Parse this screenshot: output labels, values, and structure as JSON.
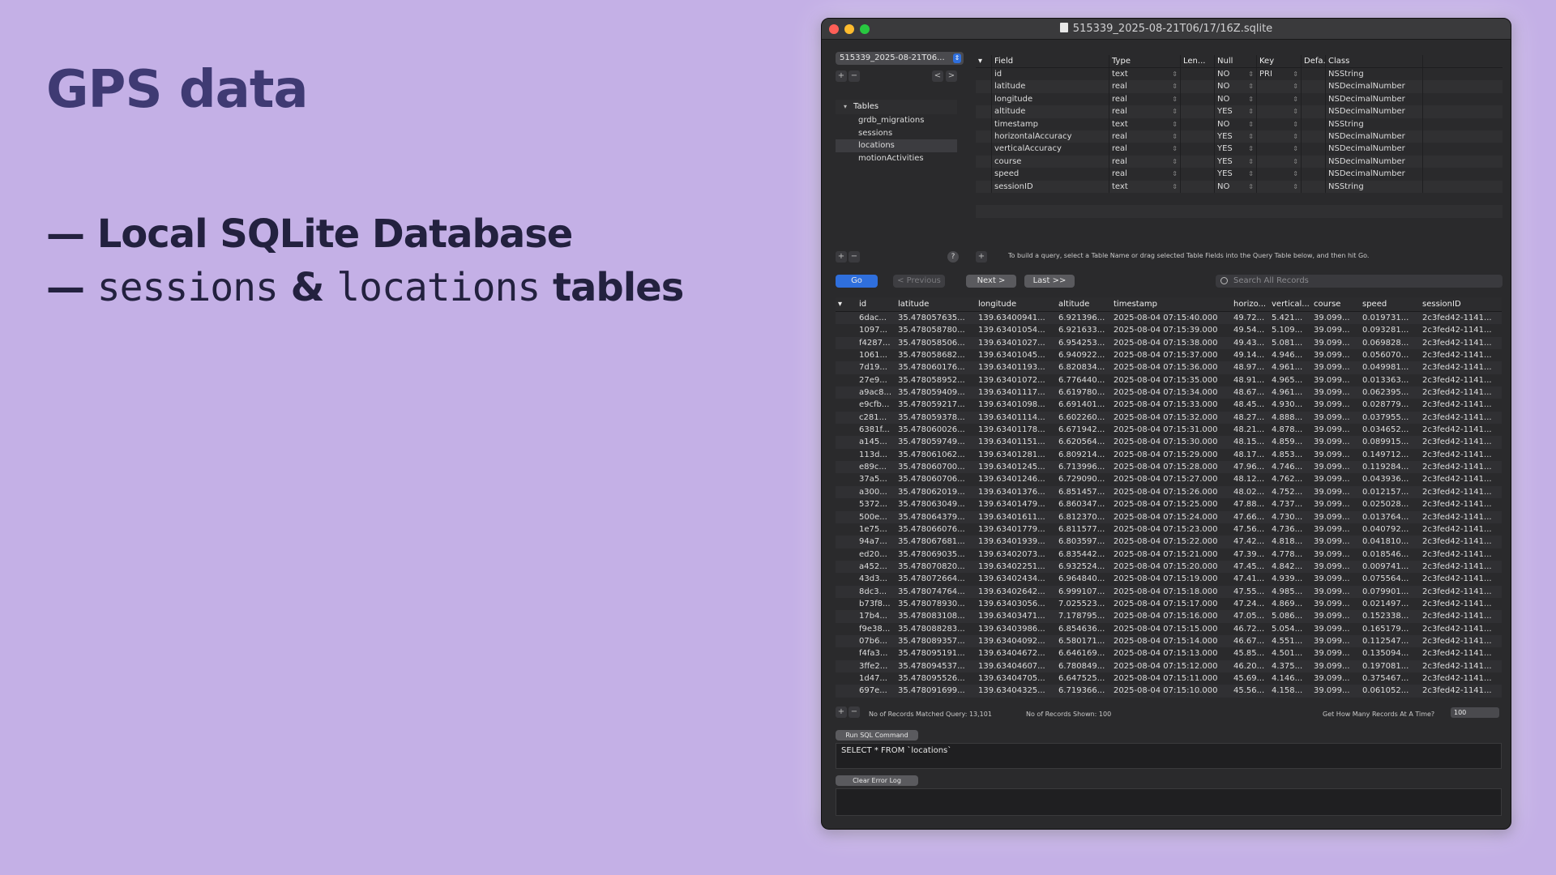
{
  "slide": {
    "title": "GPS data",
    "bullet1": "— Local SQLite Database",
    "bullet2_dash": "— ",
    "bullet2_mono1": "sessions",
    "bullet2_amp": " & ",
    "bullet2_mono2": "locations",
    "bullet2_tail": " tables"
  },
  "window": {
    "title": "515339_2025-08-21T06/17/16Z.sqlite",
    "db_select": "515339_2025-08-21T06...",
    "tables_header": "Tables",
    "tables": [
      "grdb_migrations",
      "sessions",
      "locations",
      "motionActivities"
    ],
    "field_headers": [
      "Field",
      "Type",
      "Len...",
      "Null",
      "Key",
      "Defa...",
      "Class"
    ],
    "fields": [
      [
        "id",
        "text",
        "",
        "NO",
        "PRI",
        "",
        "NSString"
      ],
      [
        "latitude",
        "real",
        "",
        "NO",
        "",
        "",
        "NSDecimalNumber"
      ],
      [
        "longitude",
        "real",
        "",
        "NO",
        "",
        "",
        "NSDecimalNumber"
      ],
      [
        "altitude",
        "real",
        "",
        "YES",
        "",
        "",
        "NSDecimalNumber"
      ],
      [
        "timestamp",
        "text",
        "",
        "NO",
        "",
        "",
        "NSString"
      ],
      [
        "horizontalAccuracy",
        "real",
        "",
        "YES",
        "",
        "",
        "NSDecimalNumber"
      ],
      [
        "verticalAccuracy",
        "real",
        "",
        "YES",
        "",
        "",
        "NSDecimalNumber"
      ],
      [
        "course",
        "real",
        "",
        "YES",
        "",
        "",
        "NSDecimalNumber"
      ],
      [
        "speed",
        "real",
        "",
        "YES",
        "",
        "",
        "NSDecimalNumber"
      ],
      [
        "sessionID",
        "text",
        "",
        "NO",
        "",
        "",
        "NSString"
      ]
    ],
    "query_hint": "To build a query, select a Table Name or drag selected Table Fields into the Query Table below, and then hit Go.",
    "buttons": {
      "go": "Go",
      "previous": "< Previous",
      "next": "Next >",
      "last": "Last >>",
      "run_sql": "Run SQL Command",
      "clear_error": "Clear Error Log"
    },
    "search_placeholder": "Search All Records",
    "record_headers": [
      "id",
      "latitude",
      "longitude",
      "altitude",
      "timestamp",
      "horizo...",
      "vertical...",
      "course",
      "speed",
      "sessionID"
    ],
    "records": [
      [
        "6dac...",
        "35.478057635...",
        "139.63400941...",
        "6.921396...",
        "2025-08-04 07:15:40.000",
        "49.72...",
        "5.421...",
        "39.099...",
        "0.019731...",
        "2c3fed42-1141..."
      ],
      [
        "1097...",
        "35.478058780...",
        "139.63401054...",
        "6.921633...",
        "2025-08-04 07:15:39.000",
        "49.54...",
        "5.109...",
        "39.099...",
        "0.093281...",
        "2c3fed42-1141..."
      ],
      [
        "f4287...",
        "35.478058506...",
        "139.63401027...",
        "6.954253...",
        "2025-08-04 07:15:38.000",
        "49.43...",
        "5.081...",
        "39.099...",
        "0.069828...",
        "2c3fed42-1141..."
      ],
      [
        "1061...",
        "35.478058682...",
        "139.63401045...",
        "6.940922...",
        "2025-08-04 07:15:37.000",
        "49.14...",
        "4.946...",
        "39.099...",
        "0.056070...",
        "2c3fed42-1141..."
      ],
      [
        "7d19...",
        "35.478060176...",
        "139.63401193...",
        "6.820834...",
        "2025-08-04 07:15:36.000",
        "48.97...",
        "4.961...",
        "39.099...",
        "0.049981...",
        "2c3fed42-1141..."
      ],
      [
        "27e9...",
        "35.478058952...",
        "139.63401072...",
        "6.776440...",
        "2025-08-04 07:15:35.000",
        "48.91...",
        "4.965...",
        "39.099...",
        "0.013363...",
        "2c3fed42-1141..."
      ],
      [
        "a9ac8...",
        "35.478059409...",
        "139.63401117...",
        "6.619780...",
        "2025-08-04 07:15:34.000",
        "48.67...",
        "4.961...",
        "39.099...",
        "0.062395...",
        "2c3fed42-1141..."
      ],
      [
        "e9cfb...",
        "35.478059217...",
        "139.63401098...",
        "6.691401...",
        "2025-08-04 07:15:33.000",
        "48.45...",
        "4.930...",
        "39.099...",
        "0.028779...",
        "2c3fed42-1141..."
      ],
      [
        "c281...",
        "35.478059378...",
        "139.63401114...",
        "6.602260...",
        "2025-08-04 07:15:32.000",
        "48.27...",
        "4.888...",
        "39.099...",
        "0.037955...",
        "2c3fed42-1141..."
      ],
      [
        "6381f...",
        "35.478060026...",
        "139.63401178...",
        "6.671942...",
        "2025-08-04 07:15:31.000",
        "48.21...",
        "4.878...",
        "39.099...",
        "0.034652...",
        "2c3fed42-1141..."
      ],
      [
        "a145...",
        "35.478059749...",
        "139.63401151...",
        "6.620564...",
        "2025-08-04 07:15:30.000",
        "48.15...",
        "4.859...",
        "39.099...",
        "0.089915...",
        "2c3fed42-1141..."
      ],
      [
        "113d...",
        "35.478061062...",
        "139.63401281...",
        "6.809214...",
        "2025-08-04 07:15:29.000",
        "48.17...",
        "4.853...",
        "39.099...",
        "0.149712...",
        "2c3fed42-1141..."
      ],
      [
        "e89c...",
        "35.478060700...",
        "139.63401245...",
        "6.713996...",
        "2025-08-04 07:15:28.000",
        "47.96...",
        "4.746...",
        "39.099...",
        "0.119284...",
        "2c3fed42-1141..."
      ],
      [
        "37a5...",
        "35.478060706...",
        "139.63401246...",
        "6.729090...",
        "2025-08-04 07:15:27.000",
        "48.12...",
        "4.762...",
        "39.099...",
        "0.043936...",
        "2c3fed42-1141..."
      ],
      [
        "a300...",
        "35.478062019...",
        "139.63401376...",
        "6.851457...",
        "2025-08-04 07:15:26.000",
        "48.02...",
        "4.752...",
        "39.099...",
        "0.012157...",
        "2c3fed42-1141..."
      ],
      [
        "5372...",
        "35.478063049...",
        "139.63401479...",
        "6.860347...",
        "2025-08-04 07:15:25.000",
        "47.88...",
        "4.737...",
        "39.099...",
        "0.025028...",
        "2c3fed42-1141..."
      ],
      [
        "500e...",
        "35.478064379...",
        "139.63401611...",
        "6.812370...",
        "2025-08-04 07:15:24.000",
        "47.66...",
        "4.730...",
        "39.099...",
        "0.013764...",
        "2c3fed42-1141..."
      ],
      [
        "1e75...",
        "35.478066076...",
        "139.63401779...",
        "6.811577...",
        "2025-08-04 07:15:23.000",
        "47.56...",
        "4.736...",
        "39.099...",
        "0.040792...",
        "2c3fed42-1141..."
      ],
      [
        "94a7...",
        "35.478067681...",
        "139.63401939...",
        "6.803597...",
        "2025-08-04 07:15:22.000",
        "47.42...",
        "4.818...",
        "39.099...",
        "0.041810...",
        "2c3fed42-1141..."
      ],
      [
        "ed20...",
        "35.478069035...",
        "139.63402073...",
        "6.835442...",
        "2025-08-04 07:15:21.000",
        "47.39...",
        "4.778...",
        "39.099...",
        "0.018546...",
        "2c3fed42-1141..."
      ],
      [
        "a452...",
        "35.478070820...",
        "139.63402251...",
        "6.932524...",
        "2025-08-04 07:15:20.000",
        "47.45...",
        "4.842...",
        "39.099...",
        "0.009741...",
        "2c3fed42-1141..."
      ],
      [
        "43d3...",
        "35.478072664...",
        "139.63402434...",
        "6.964840...",
        "2025-08-04 07:15:19.000",
        "47.41...",
        "4.939...",
        "39.099...",
        "0.075564...",
        "2c3fed42-1141..."
      ],
      [
        "8dc3...",
        "35.478074764...",
        "139.63402642...",
        "6.999107...",
        "2025-08-04 07:15:18.000",
        "47.55...",
        "4.985...",
        "39.099...",
        "0.079901...",
        "2c3fed42-1141..."
      ],
      [
        "b73f8...",
        "35.478078930...",
        "139.63403056...",
        "7.025523...",
        "2025-08-04 07:15:17.000",
        "47.24...",
        "4.869...",
        "39.099...",
        "0.021497...",
        "2c3fed42-1141..."
      ],
      [
        "17b4...",
        "35.478083108...",
        "139.63403471...",
        "7.178795...",
        "2025-08-04 07:15:16.000",
        "47.05...",
        "5.086...",
        "39.099...",
        "0.152338...",
        "2c3fed42-1141..."
      ],
      [
        "f9e38...",
        "35.478088283...",
        "139.63403986...",
        "6.854636...",
        "2025-08-04 07:15:15.000",
        "46.72...",
        "5.054...",
        "39.099...",
        "0.165179...",
        "2c3fed42-1141..."
      ],
      [
        "07b6...",
        "35.478089357...",
        "139.63404092...",
        "6.580171...",
        "2025-08-04 07:15:14.000",
        "46.67...",
        "4.551...",
        "39.099...",
        "0.112547...",
        "2c3fed42-1141..."
      ],
      [
        "f4fa3...",
        "35.478095191...",
        "139.63404672...",
        "6.646169...",
        "2025-08-04 07:15:13.000",
        "45.85...",
        "4.501...",
        "39.099...",
        "0.135094...",
        "2c3fed42-1141..."
      ],
      [
        "3ffe2...",
        "35.478094537...",
        "139.63404607...",
        "6.780849...",
        "2025-08-04 07:15:12.000",
        "46.20...",
        "4.375...",
        "39.099...",
        "0.197081...",
        "2c3fed42-1141..."
      ],
      [
        "1d47...",
        "35.478095526...",
        "139.63404705...",
        "6.647525...",
        "2025-08-04 07:15:11.000",
        "45.69...",
        "4.146...",
        "39.099...",
        "0.375467...",
        "2c3fed42-1141..."
      ],
      [
        "697e...",
        "35.478091699...",
        "139.63404325...",
        "6.719366...",
        "2025-08-04 07:15:10.000",
        "45.56...",
        "4.158...",
        "39.099...",
        "0.061052...",
        "2c3fed42-1141..."
      ]
    ],
    "records_matched": "No of Records Matched Query: 13,101",
    "records_shown": "No of Records Shown: 100",
    "records_limit_label": "Get How Many Records At A Time?",
    "records_limit": "100",
    "sql": "SELECT * FROM `locations`"
  }
}
